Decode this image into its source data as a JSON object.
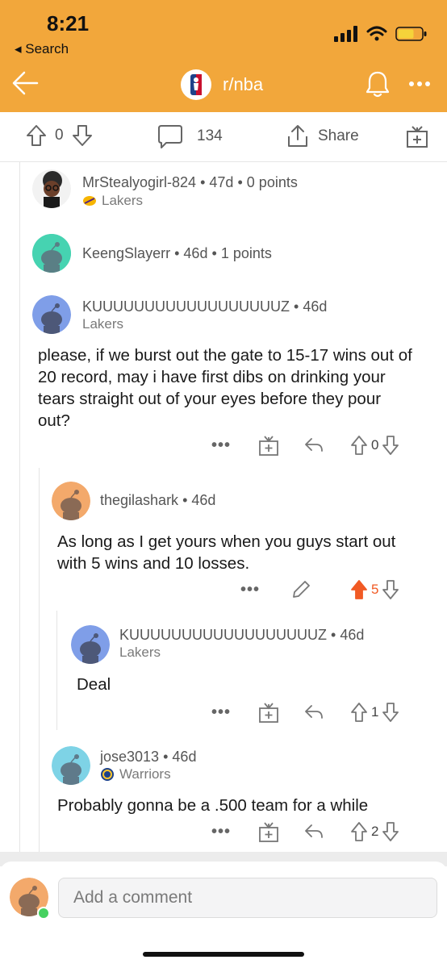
{
  "status": {
    "time": "8:21",
    "back_label": "◂ Search"
  },
  "nav": {
    "subreddit": "r/nba"
  },
  "colors": {
    "header": "#f2a73b",
    "upvote_active": "#f15a24",
    "accent_blue": "#4a7bd0"
  },
  "action_bar": {
    "vote_count": "0",
    "comment_count": "134",
    "share_label": "Share"
  },
  "comments": [
    {
      "author": "MrStealyogirl-824",
      "age": "47d",
      "points": "0 points",
      "flair": "Lakers"
    },
    {
      "author": "KeengSlayerr",
      "age": "46d",
      "points": "1 points"
    },
    {
      "author": "KUUUUUUUUUUUUUUUUUUZ",
      "age": "46d",
      "flair": "Lakers",
      "body": "please, if we burst out the gate to 15-17 wins out of 20 record, may i have first dibs on drinking your tears straight out of your eyes before they pour out?",
      "score": "0"
    },
    {
      "author": "thegilashark",
      "age": "46d",
      "body": "As long as I get yours when you guys start out with 5 wins and 10 losses.",
      "score": "5"
    },
    {
      "author": "KUUUUUUUUUUUUUUUUUUZ",
      "age": "46d",
      "flair": "Lakers",
      "body": "Deal",
      "score": "1"
    },
    {
      "author": "jose3013",
      "age": "46d",
      "flair": "Warriors",
      "body": "Probably gonna be a .500 team for a while",
      "score": "2"
    }
  ],
  "composer": {
    "placeholder": "Add a comment"
  },
  "separator": "•",
  "dots": "•••"
}
